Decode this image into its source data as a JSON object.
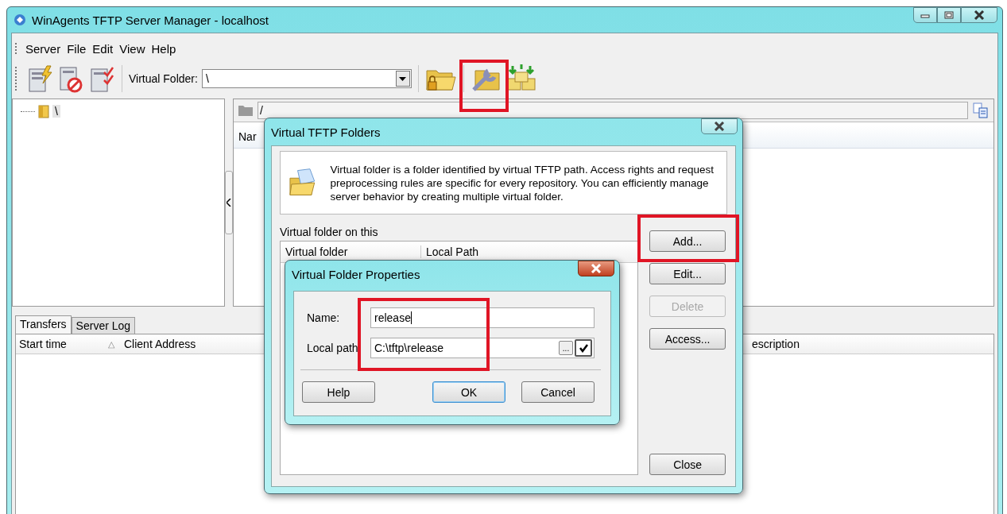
{
  "window": {
    "title": "WinAgents TFTP Server Manager - localhost"
  },
  "menu": [
    "Server",
    "File",
    "Edit",
    "View",
    "Help"
  ],
  "toolbar": {
    "virtual_folder_label": "Virtual Folder:",
    "virtual_folder_value": "\\"
  },
  "tree": [
    {
      "label": "\\",
      "selected": true
    }
  ],
  "path_bar": {
    "value": "/"
  },
  "file_list": {
    "columns": [
      "Nar"
    ]
  },
  "bottom_tabs": [
    {
      "label": "Transfers",
      "selected": true
    },
    {
      "label": "Server Log",
      "selected": false
    }
  ],
  "transfers_table": {
    "columns": [
      {
        "label": "Start time",
        "sort_mark": "△"
      },
      {
        "label": "Client Address"
      },
      {
        "label": "escription"
      }
    ]
  },
  "folders_dialog": {
    "title": "Virtual TFTP Folders",
    "info": "Virtual folder is a folder identified by virtual TFTP path. Access rights and request preprocessing rules are specific for every repository. You can efficiently manage server behavior by creating multiple virtual folder.",
    "list_label": "Virtual folder on this",
    "columns": [
      "Virtual folder",
      "Local Path"
    ],
    "buttons": [
      {
        "label": "Add...",
        "disabled": false
      },
      {
        "label": "Edit...",
        "disabled": false
      },
      {
        "label": "Delete",
        "disabled": true
      },
      {
        "label": "Access...",
        "disabled": false
      }
    ],
    "close_button": "Close"
  },
  "properties_dialog": {
    "title": "Virtual Folder Properties",
    "fields": [
      {
        "label": "Name:",
        "value": "release"
      },
      {
        "label": "Local path",
        "value": "C:\\tftp\\release"
      }
    ],
    "browse_label": "...",
    "path_check": true,
    "buttons": [
      {
        "label": "Help",
        "default": false
      },
      {
        "label": "OK",
        "default": true
      },
      {
        "label": "Cancel",
        "default": false
      }
    ]
  }
}
